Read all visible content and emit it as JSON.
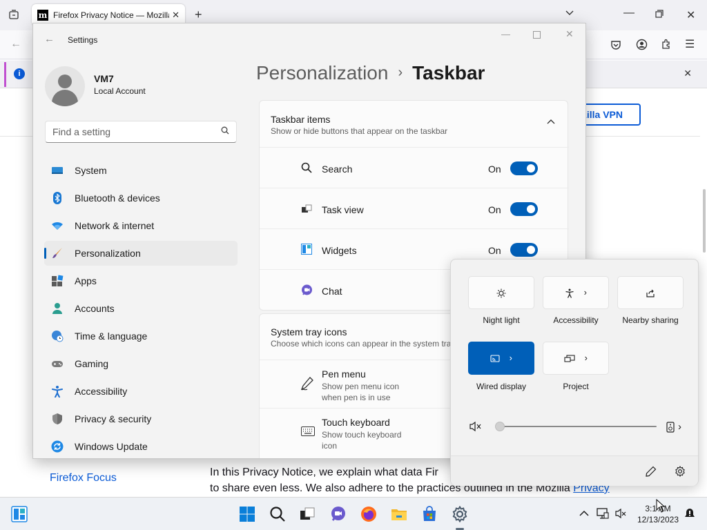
{
  "browser": {
    "tab_title": "Firefox Privacy Notice — Mozilla",
    "vpn_button": "zilla VPN",
    "focus_link": "Firefox Focus",
    "text_line1": "In this Privacy Notice, we explain what data Fir",
    "text_line2a": "to share even less. We also adhere to the practices outlined in the Mozilla ",
    "text_line2b": "Privacy"
  },
  "settings": {
    "window_title": "Settings",
    "user_name": "VM7",
    "user_type": "Local Account",
    "search_placeholder": "Find a setting",
    "nav": [
      {
        "label": "System"
      },
      {
        "label": "Bluetooth & devices"
      },
      {
        "label": "Network & internet"
      },
      {
        "label": "Personalization"
      },
      {
        "label": "Apps"
      },
      {
        "label": "Accounts"
      },
      {
        "label": "Time & language"
      },
      {
        "label": "Gaming"
      },
      {
        "label": "Accessibility"
      },
      {
        "label": "Privacy & security"
      },
      {
        "label": "Windows Update"
      }
    ],
    "breadcrumb_parent": "Personalization",
    "breadcrumb_current": "Taskbar",
    "taskbar_items": {
      "title": "Taskbar items",
      "subtitle": "Show or hide buttons that appear on the taskbar",
      "rows": [
        {
          "label": "Search",
          "state": "On"
        },
        {
          "label": "Task view",
          "state": "On"
        },
        {
          "label": "Widgets",
          "state": "On"
        },
        {
          "label": "Chat"
        }
      ]
    },
    "tray_icons": {
      "title": "System tray icons",
      "subtitle": "Choose which icons can appear in the system tra",
      "rows": [
        {
          "label": "Pen menu",
          "desc": "Show pen menu icon when pen is in use"
        },
        {
          "label": "Touch keyboard",
          "desc": "Show touch keyboard icon"
        }
      ]
    }
  },
  "quick_settings": {
    "tiles": [
      {
        "label": "Night light",
        "active": false
      },
      {
        "label": "Accessibility",
        "active": false
      },
      {
        "label": "Nearby sharing",
        "active": false
      },
      {
        "label": "Wired display",
        "active": true
      },
      {
        "label": "Project",
        "active": false
      }
    ],
    "volume_percent": 0
  },
  "taskbar": {
    "time": "3:1 AM",
    "date": "12/13/2023"
  },
  "colors": {
    "accent": "#005fb8",
    "link": "#0b5bd6"
  }
}
